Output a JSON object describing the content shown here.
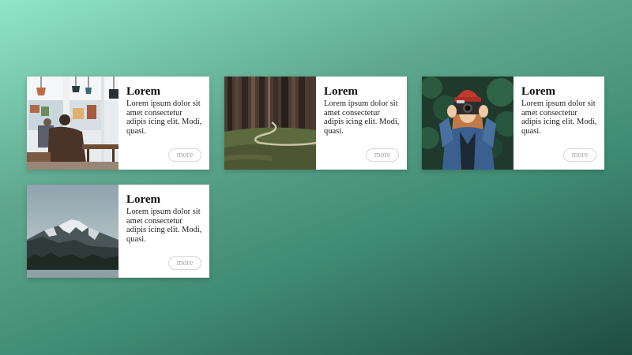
{
  "cards": [
    {
      "image_icon": "cafe-photo",
      "title": "Lorem",
      "text": "Lorem ipsum dolor sit amet consectetur adipis icing elit. Modi, quasi.",
      "button_label": "more"
    },
    {
      "image_icon": "forest-path-photo",
      "title": "Lorem",
      "text": "Lorem ipsum dolor sit amet consectetur adipis icing elit. Modi, quasi.",
      "button_label": "more"
    },
    {
      "image_icon": "photographer-photo",
      "title": "Lorem",
      "text": "Lorem ipsum dolor sit amet consectetur adipis icing elit. Modi, quasi.",
      "button_label": "more"
    },
    {
      "image_icon": "mountain-photo",
      "title": "Lorem",
      "text": "Lorem ipsum dolor sit amet consectetur adipis icing elit. Modi, quasi.",
      "button_label": "more"
    }
  ],
  "colors": {
    "background_start": "#8fe6c8",
    "background_end": "#1f4d40",
    "card_background": "#ffffff",
    "button_text": "#a8a8a8"
  }
}
